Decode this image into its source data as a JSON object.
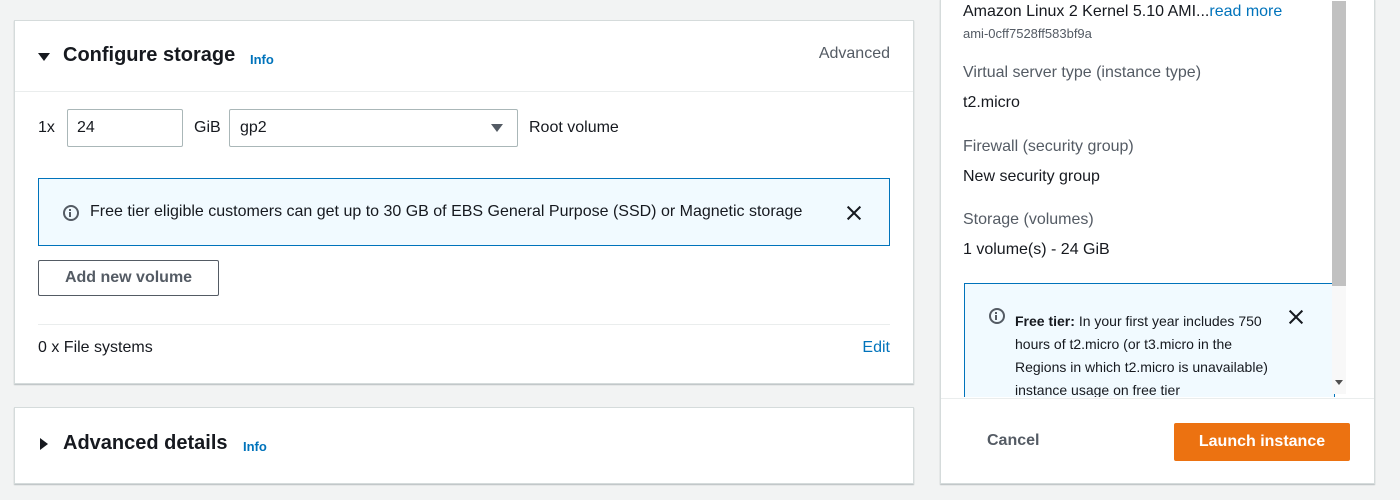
{
  "storage": {
    "title": "Configure storage",
    "info_label": "Info",
    "advanced_link": "Advanced",
    "volume_count": "1x",
    "volume_size": "24",
    "size_unit": "GiB",
    "volume_type": "gp2",
    "volume_role": "Root volume",
    "alert_text": "Free tier eligible customers can get up to 30 GB of EBS General Purpose (SSD) or Magnetic storage",
    "add_volume_button": "Add new volume",
    "file_systems": "0 x File systems",
    "edit_link": "Edit"
  },
  "advanced_details": {
    "title": "Advanced details",
    "info_label": "Info"
  },
  "summary": {
    "ami_name": "Amazon Linux 2 Kernel 5.10 AMI...",
    "read_more": "read more",
    "ami_id": "ami-0cff7528ff583bf9a",
    "instance_type_label": "Virtual server type (instance type)",
    "instance_type_value": "t2.micro",
    "firewall_label": "Firewall (security group)",
    "firewall_value": "New security group",
    "storage_label": "Storage (volumes)",
    "storage_value": "1 volume(s) - 24 GiB",
    "free_tier_label": "Free tier:",
    "free_tier_text": "In your first year includes 750 hours of t2.micro (or t3.micro in the Regions in which t2.micro is unavailable) instance usage on free tier",
    "cancel_button": "Cancel",
    "launch_button": "Launch instance"
  },
  "icons": {
    "collapse": "caret-down-icon",
    "expand": "caret-right-icon",
    "select": "triangle-down-icon",
    "info": "info-circle-icon",
    "dismiss": "close-icon"
  },
  "colors": {
    "link_blue": "#0073bb",
    "primary_orange": "#ec7211",
    "alert_bg": "#f1faff",
    "page_bg": "#f2f3f3"
  }
}
